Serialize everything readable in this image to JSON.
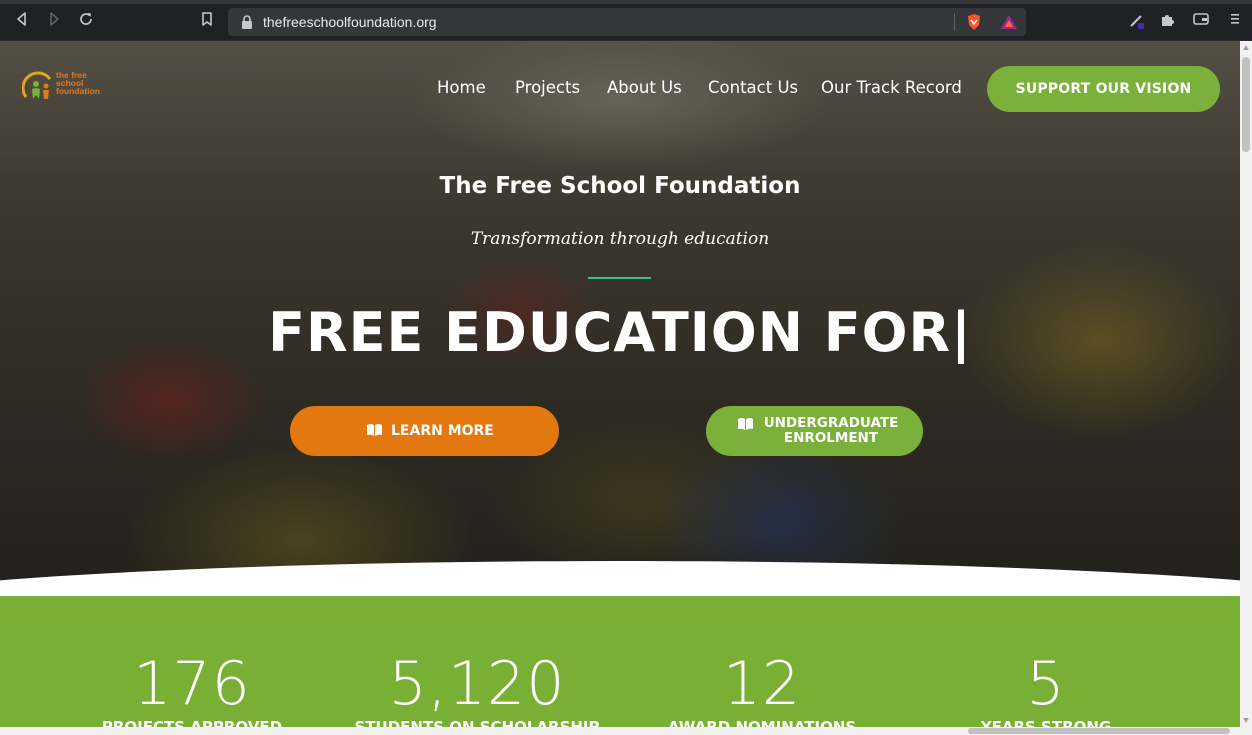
{
  "browser": {
    "url": "thefreeschoolfoundation.org"
  },
  "site": {
    "logo_text": "the free\nschool\nfoundation",
    "nav": [
      "Home",
      "Projects",
      "About Us",
      "Contact Us",
      "Our Track Record"
    ],
    "support_button": "SUPPORT OUR VISION",
    "hero_title": "The Free School Foundation",
    "hero_tagline": "Transformation through education",
    "hero_headline": "FREE EDUCATION FOR|",
    "learn_more_button": "LEARN MORE",
    "enrolment_button": "UNDERGRADUATE ENROLMENT",
    "stats": [
      {
        "value": "176",
        "label": "PROJECTS APPROVED"
      },
      {
        "value": "5,120",
        "label": "STUDENTS ON SCHOLARSHIP"
      },
      {
        "value": "12",
        "label": "AWARD NOMINATIONS"
      },
      {
        "value": "5",
        "label": "YEARS STRONG"
      }
    ]
  },
  "colors": {
    "green": "#7bb03a",
    "orange": "#e2780f",
    "divider": "#2ec48a"
  },
  "icons": {
    "back": "back-icon",
    "forward": "forward-icon",
    "reload": "reload-icon",
    "bookmark": "bookmark-icon",
    "lock": "lock-icon",
    "book": "book-icon"
  }
}
